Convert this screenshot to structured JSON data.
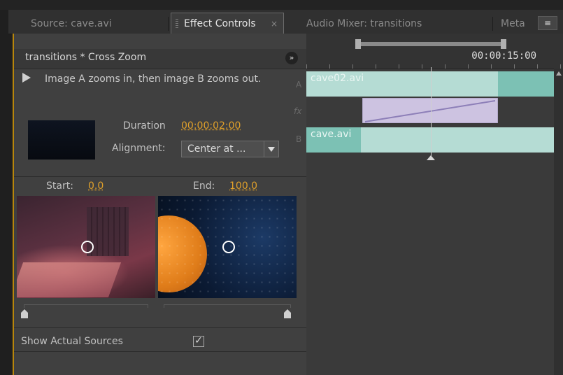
{
  "tabs": [
    {
      "label": "Source: cave.avi",
      "active": false
    },
    {
      "label": "Effect Controls",
      "active": true,
      "close": "×"
    },
    {
      "label": "Audio Mixer: transitions",
      "active": false
    },
    {
      "label": "Meta",
      "active": false
    }
  ],
  "panel_menu_icon": "≡",
  "effect": {
    "title": "transitions * Cross Zoom",
    "description": "Image A zooms in, then image B zooms out.",
    "duration_label": "Duration",
    "duration_value": "00:00:02:00",
    "alignment_label": "Alignment:",
    "alignment_value": "Center at ...",
    "start_label": "Start:",
    "start_value": "0.0",
    "end_label": "End:",
    "end_value": "100.0",
    "show_sources_label": "Show Actual Sources",
    "show_sources_checked": true,
    "check_mark": "✓"
  },
  "timeline": {
    "timecode": "00:00:15:00",
    "track_a_letter": "A",
    "track_fx_letter": "fx",
    "track_b_letter": "B",
    "clip_a": "cave02.avi",
    "clip_b": "cave.avi"
  },
  "colors": {
    "accent_orange": "#e0a02a",
    "clip_teal": "#b5dcd4",
    "clip_teal_dark": "#7cc1b4",
    "transition_lavender": "#cdc3e1",
    "transition_line": "#8d7fb8"
  }
}
